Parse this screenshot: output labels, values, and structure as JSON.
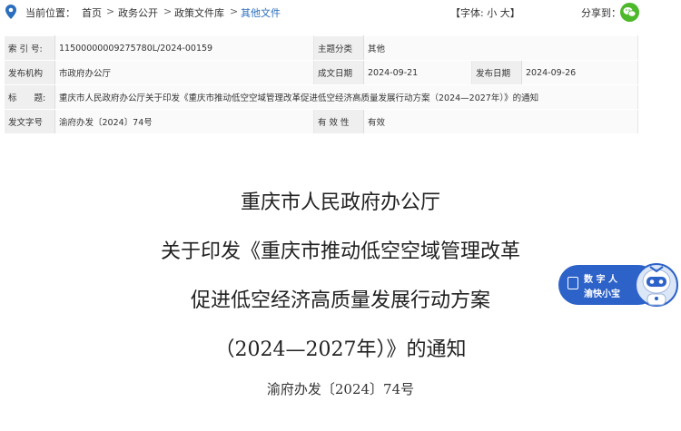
{
  "breadcrumb": {
    "current_label": "当前位置：",
    "items": [
      "首页",
      "政务公开",
      "政策文件库",
      "其他文件"
    ],
    "separator": ">"
  },
  "font_size": {
    "prefix": "【字体:",
    "small": "小",
    "large": "大",
    "suffix": "】"
  },
  "share": {
    "label": "分享到：",
    "icon": "wechat-icon"
  },
  "info": {
    "index_label": "索 引 号:",
    "index_value": "11500000009275780L/2024-00159",
    "subject_label": "主题分类",
    "subject_value": "其他",
    "issuer_label": "发布机构",
    "issuer_value": "市政府办公厅",
    "created_label": "成文日期",
    "created_value": "2024-09-21",
    "published_label": "发布日期",
    "published_value": "2024-09-26",
    "title_label": "标　　题:",
    "title_value": "重庆市人民政府办公厅关于印发《重庆市推动低空空域管理改革促进低空经济高质量发展行动方案（2024—2027年）》的通知",
    "docno_label": "发文字号",
    "docno_value": "渝府办发〔2024〕74号",
    "validity_label": "有 效 性",
    "validity_value": "有效"
  },
  "document": {
    "title_lines": [
      "重庆市人民政府办公厅",
      "关于印发《重庆市推动低空空域管理改革",
      "促进低空经济高质量发展行动方案",
      "（2024—2027年）》的通知"
    ],
    "doc_number": "渝府办发〔2024〕74号"
  },
  "assistant": {
    "line1": "数 字 人",
    "line2": "渝快小宝"
  },
  "colors": {
    "link": "#2a6ebd",
    "location_icon": "#2a6ebd",
    "wechat": "#4cb82a",
    "assistant": "#2d62c8"
  }
}
